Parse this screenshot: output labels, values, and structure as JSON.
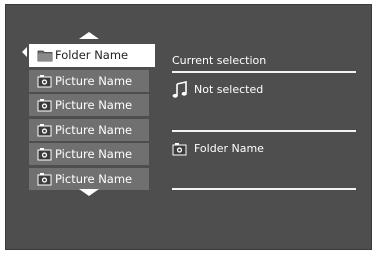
{
  "list": {
    "items": [
      {
        "label": "Folder Name",
        "icon": "folder-icon",
        "selected": true
      },
      {
        "label": "Picture Name",
        "icon": "picture-icon",
        "selected": false
      },
      {
        "label": "Picture Name",
        "icon": "picture-icon",
        "selected": false
      },
      {
        "label": "Picture Name",
        "icon": "picture-icon",
        "selected": false
      },
      {
        "label": "Picture Name",
        "icon": "picture-icon",
        "selected": false
      },
      {
        "label": "Picture Name",
        "icon": "picture-icon",
        "selected": false
      }
    ]
  },
  "panel": {
    "title": "Current selection",
    "music_status": "Not selected",
    "folder_label": "Folder Name"
  },
  "colors": {
    "background": "#4e4e4e",
    "item": "#707070",
    "selected_item": "#ffffff",
    "text": "#ffffff"
  }
}
